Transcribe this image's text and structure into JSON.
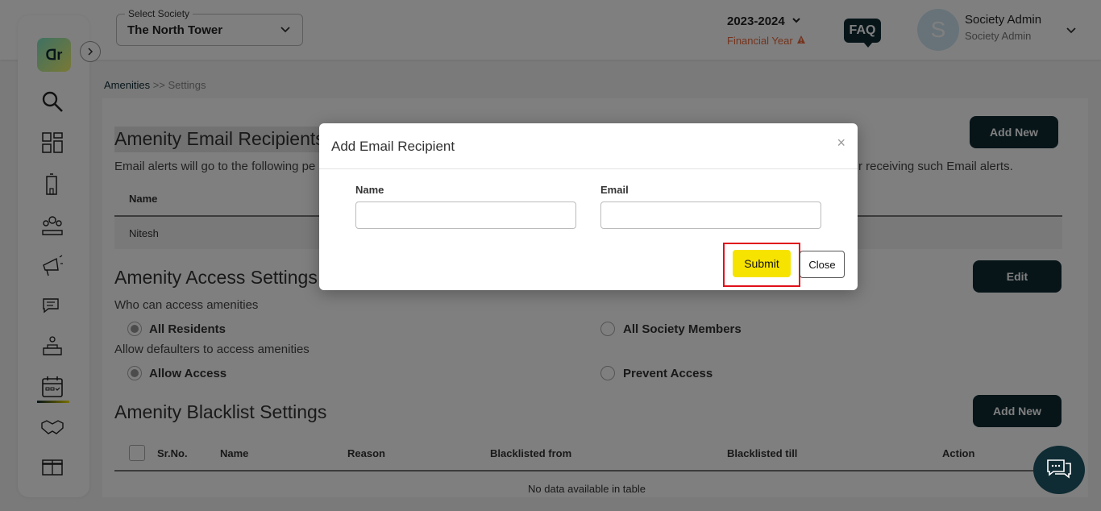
{
  "header": {
    "society_label": "Select Society",
    "society_value": "The North Tower",
    "year": "2023-2024",
    "financial_year_label": "Financial Year",
    "faq_label": "FAQ",
    "avatar_initial": "S",
    "user_name": "Society Admin",
    "user_role": "Society Admin"
  },
  "sidebar": {
    "logo_text": "ꓷr",
    "items": [
      "search-icon",
      "dashboard-icon",
      "building-icon",
      "members-icon",
      "announcement-icon",
      "chat-icon",
      "facility-icon",
      "calendar-icon",
      "handshake-icon",
      "box-icon"
    ]
  },
  "breadcrumb": {
    "link": "Amenities",
    "separator": ">>",
    "current": "Settings"
  },
  "email_section": {
    "title": "Amenity Email Recipients",
    "desc_left": "Email alerts will go to the following pe",
    "desc_right": "r receiving such Email alerts.",
    "add_new_label": "Add New",
    "col_name": "Name",
    "row_name": "Nitesh"
  },
  "access_section": {
    "title": "Amenity Access Settings",
    "edit_label": "Edit",
    "who_label": "Who can access amenities",
    "opt_all_residents": "All Residents",
    "opt_all_members": "All Society Members",
    "defaulters_label": "Allow defaulters to access amenities",
    "opt_allow": "Allow Access",
    "opt_prevent": "Prevent Access"
  },
  "blacklist_section": {
    "title": "Amenity Blacklist Settings",
    "add_new_label": "Add New",
    "columns": [
      "Sr.No.",
      "Name",
      "Reason",
      "Blacklisted from",
      "Blacklisted till",
      "Action"
    ],
    "empty_text": "No data available in table"
  },
  "modal": {
    "title": "Add Email Recipient",
    "close_x": "×",
    "name_label": "Name",
    "email_label": "Email",
    "name_value": "",
    "email_value": "",
    "submit_label": "Submit",
    "close_label": "Close"
  },
  "colors": {
    "brand_dark": "#0f2b33",
    "accent_yellow": "#f7e300",
    "warning_orange": "#e8693c",
    "highlight_red": "#e0101a"
  }
}
